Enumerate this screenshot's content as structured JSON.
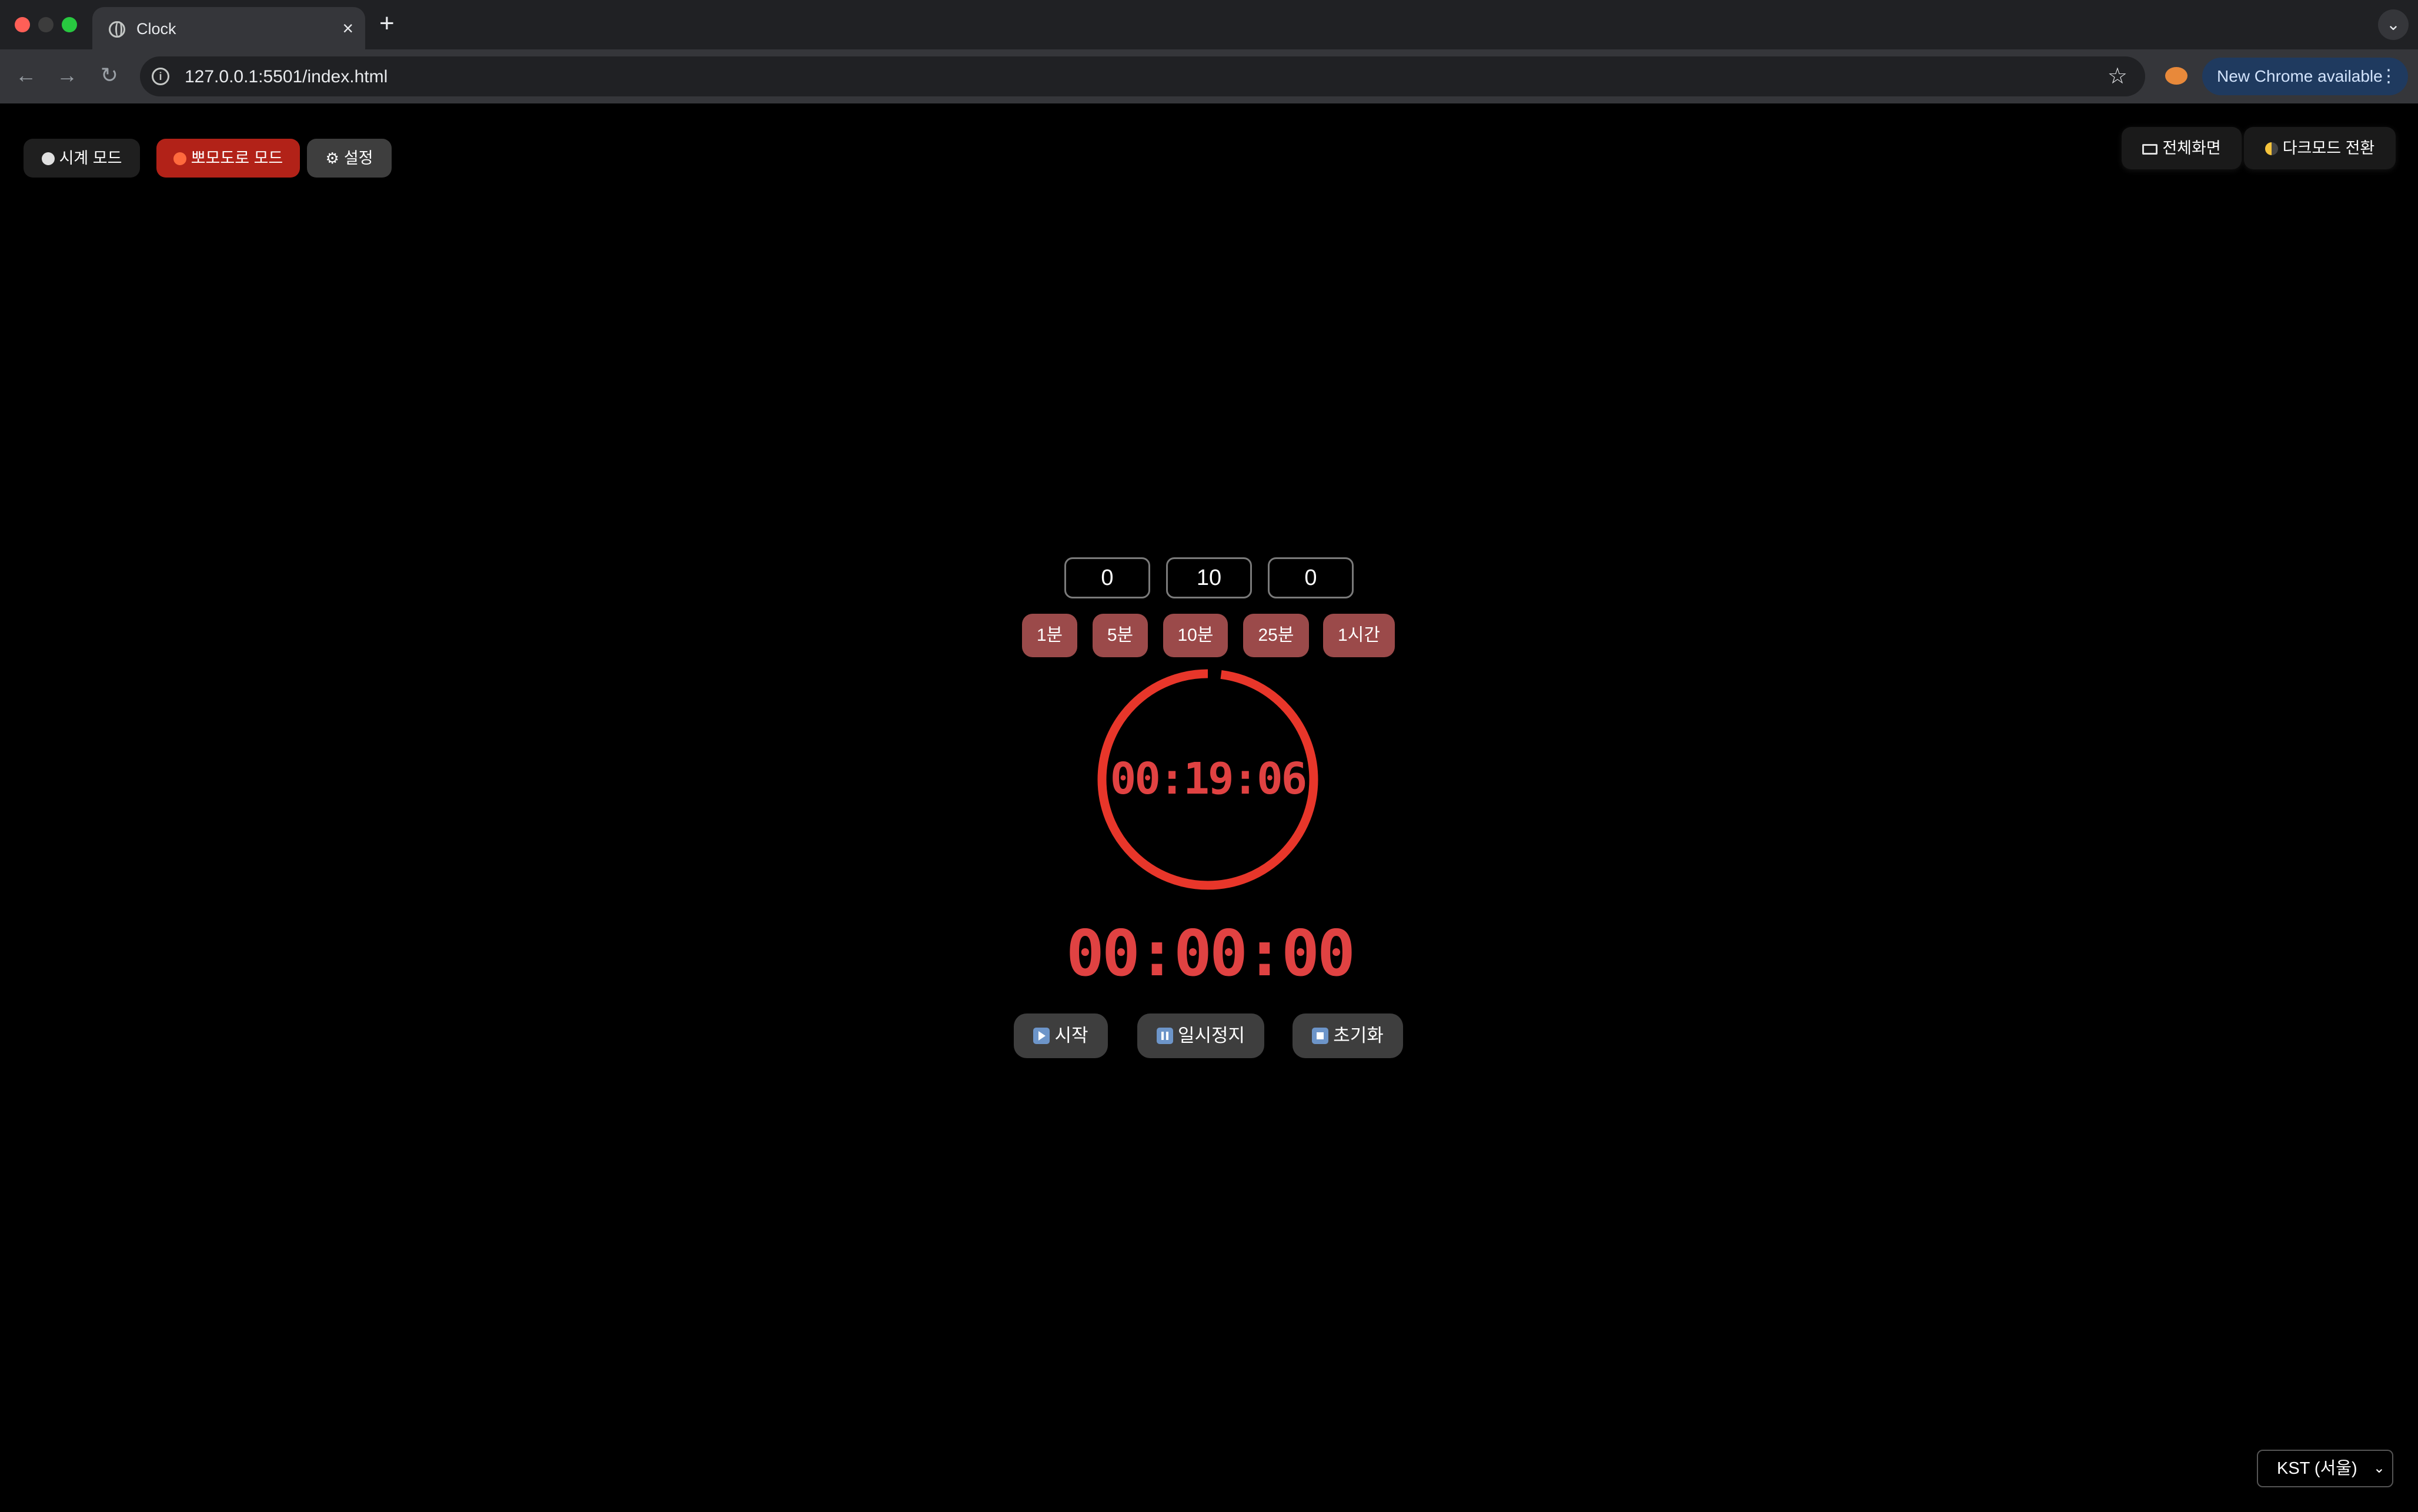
{
  "browser": {
    "tab_title": "Clock",
    "tab_close": "×",
    "new_tab": "+",
    "tab_menu": "⌄",
    "url": "127.0.0.1:5501/index.html",
    "info_icon": "i",
    "star": "☆",
    "back": "←",
    "forward": "→",
    "reload": "↻",
    "update_label": "New Chrome available",
    "update_menu": "⋮"
  },
  "modes": {
    "clock_label": "시계 모드",
    "pomodoro_label": "뽀모도로 모드",
    "settings_label": "설정"
  },
  "top_right": {
    "fullscreen_label": "전체화면",
    "darkmode_label": "다크모드 전환"
  },
  "timer_inputs": {
    "hours": "0",
    "minutes": "10",
    "seconds": "0"
  },
  "presets": [
    "1분",
    "5분",
    "10분",
    "25분",
    "1시간"
  ],
  "ring": {
    "time": "00:19:06",
    "progress": 0.98,
    "color": "#e8362a"
  },
  "countdown": "00:00:00",
  "controls": {
    "start_label": "시작",
    "pause_label": "일시정지",
    "reset_label": "초기화"
  },
  "timezone": {
    "selected": "KST (서울)",
    "chevron": "⌄"
  },
  "colors": {
    "accent": "#b22218",
    "preset_bg": "#9b4a4a",
    "digit": "#e04242"
  }
}
